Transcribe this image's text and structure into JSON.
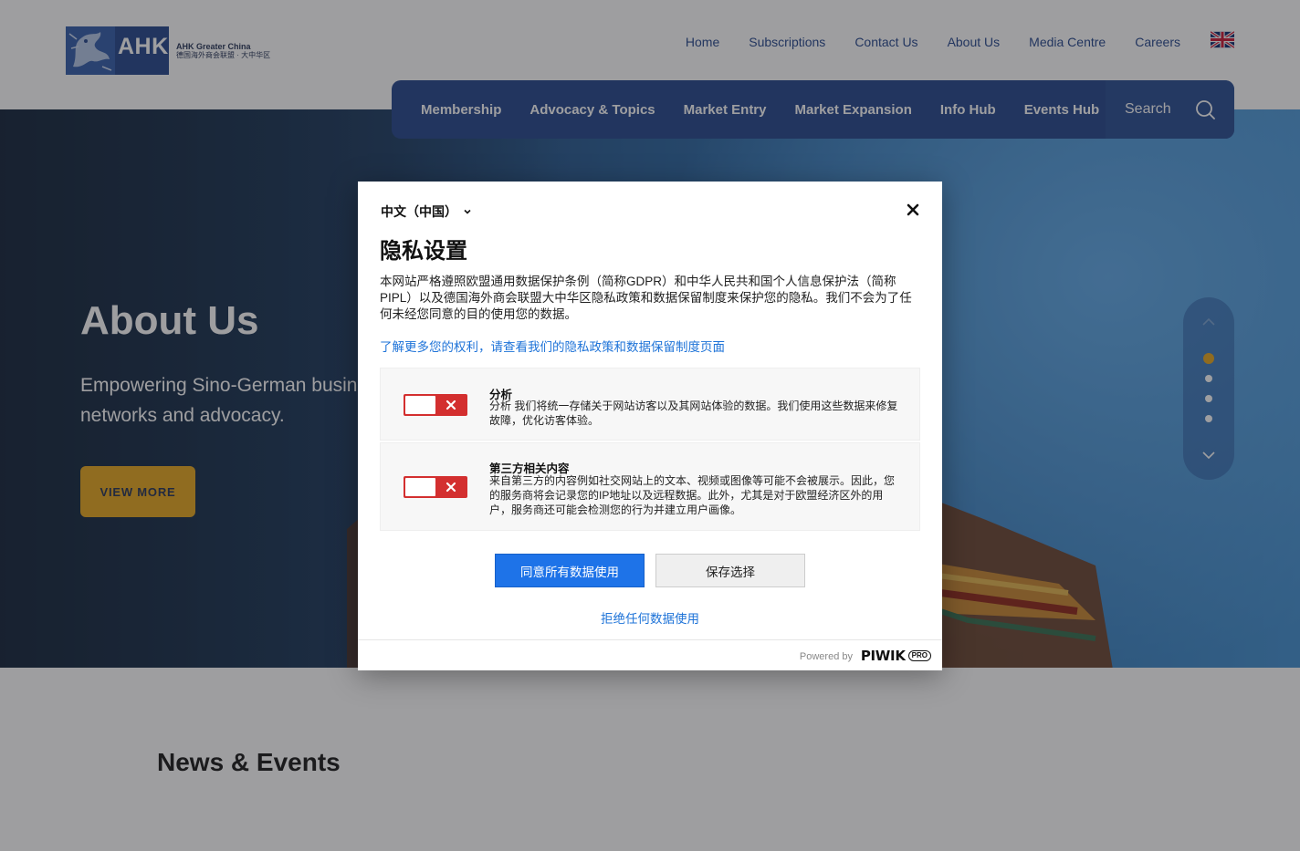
{
  "logo": {
    "letters": "AHK",
    "line1": "AHK Greater China",
    "line2": "德国海外商会联盟 · 大中华区"
  },
  "topnav": {
    "items": [
      "Home",
      "Subscriptions",
      "Contact Us",
      "About Us",
      "Media Centre",
      "Careers"
    ],
    "language_flag": "uk-flag-icon"
  },
  "mainnav": {
    "items": [
      "Membership",
      "Advocacy & Topics",
      "Market Entry",
      "Market Expansion",
      "Info Hub",
      "Events Hub"
    ],
    "search_label": "Search"
  },
  "hero": {
    "title": "About Us",
    "subtitle": "Empowering Sino-German busine networks and advocacy.",
    "button": "VIEW MORE",
    "slides_total": 4,
    "active_slide": 1
  },
  "news": {
    "heading": "News & Events"
  },
  "modal": {
    "language": "中文（中国）",
    "title": "隐私设置",
    "description": "本网站严格遵照欧盟通用数据保护条例（简称GDPR）和中华人民共和国个人信息保护法（简称PIPL）以及德国海外商会联盟大中华区隐私政策和数据保留制度来保护您的隐私。我们不会为了任何未经您同意的目的使用您的数据。",
    "link": "了解更多您的权利，请查看我们的隐私政策和数据保留制度页面",
    "options": [
      {
        "title": "分析",
        "text": "分析 我们将统一存储关于网站访客以及其网站体验的数据。我们使用这些数据来修复故障，优化访客体验。",
        "enabled": false
      },
      {
        "title": "第三方相关内容",
        "text": "来自第三方的内容例如社交网站上的文本、视频或图像等可能不会被展示。因此，您的服务商将会记录您的IP地址以及远程数据。此外，尤其是对于欧盟经济区外的用户，服务商还可能会检测您的行为并建立用户画像。",
        "enabled": false
      }
    ],
    "accept_button": "同意所有数据使用",
    "save_button": "保存选择",
    "reject_link": "拒绝任何数据使用",
    "powered_by": "Powered by",
    "brand": "PIWIK",
    "brand_badge": "PRO"
  },
  "colors": {
    "brand_blue": "#1e4189",
    "accent_gold": "#e6a417",
    "link_blue": "#1e73d8",
    "toggle_red": "#d32f2f"
  }
}
